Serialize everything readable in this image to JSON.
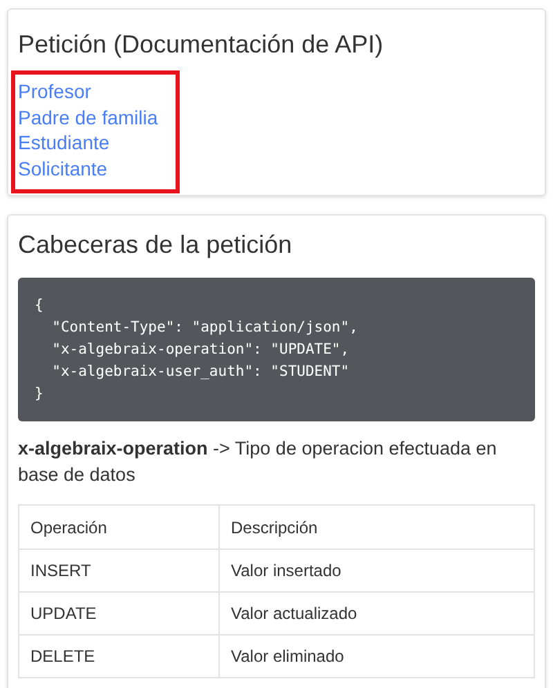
{
  "request_card": {
    "title": "Petición (Documentación de API)",
    "links": [
      "Profesor",
      "Padre de familia",
      "Estudiante",
      "Solicitante"
    ]
  },
  "headers_card": {
    "title": "Cabeceras de la petición",
    "code_lines": [
      "{",
      "  \"Content-Type\": \"application/json\",",
      "  \"x-algebraix-operation\": \"UPDATE\",",
      "  \"x-algebraix-user_auth\": \"STUDENT\"",
      "}"
    ],
    "description": "**x-algebraix-operation** -> Tipo de operacion efectuada en base de datos",
    "table": {
      "columns": [
        "Operación",
        "Descripción"
      ],
      "rows": [
        [
          "INSERT",
          "Valor insertado"
        ],
        [
          "UPDATE",
          "Valor actualizado"
        ],
        [
          "DELETE",
          "Valor eliminado"
        ]
      ]
    }
  }
}
